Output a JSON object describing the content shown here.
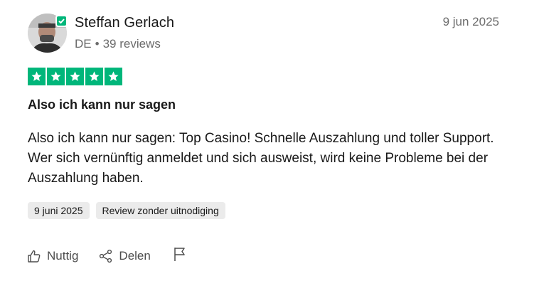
{
  "reviewer": {
    "name": "Steffan Gerlach",
    "country": "DE",
    "separator": "•",
    "reviews_count": "39 reviews",
    "verified": true
  },
  "review": {
    "date_top": "9 jun 2025",
    "rating": 5,
    "title": "Also ich kann nur sagen",
    "body": "Also ich kann nur sagen: Top Casino! Schnelle Auszahlung und toller Support. Wer sich vernünftig anmeldet und sich ausweist, wird keine Probleme bei der Auszahlung haben.",
    "tags": [
      "9 juni 2025",
      "Review zonder uitnodiging"
    ]
  },
  "actions": {
    "useful_label": "Nuttig",
    "share_label": "Delen"
  },
  "colors": {
    "star_green": "#00b67a",
    "tag_bg": "#ebebeb",
    "muted_text": "#6b6b6b"
  },
  "icons": [
    "verified-check-icon",
    "star-icon",
    "thumbs-up-icon",
    "share-icon",
    "flag-icon"
  ]
}
